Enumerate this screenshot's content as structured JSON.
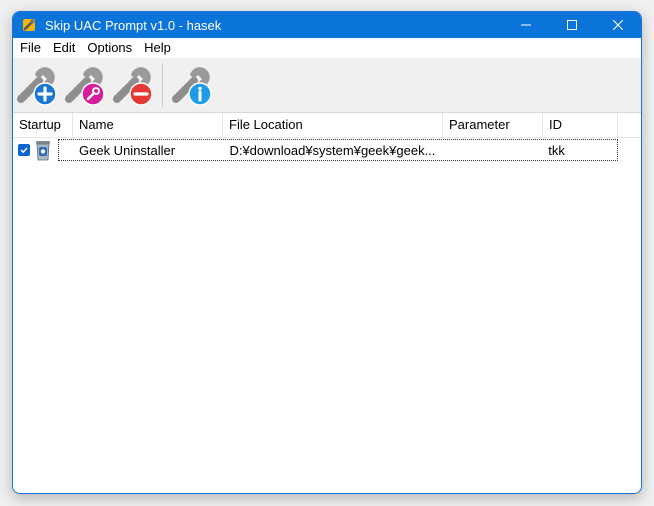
{
  "window": {
    "title": "Skip UAC Prompt v1.0 - hasek"
  },
  "menu": [
    "File",
    "Edit",
    "Options",
    "Help"
  ],
  "toolbar": {
    "buttons": [
      {
        "icon": "wrench-add-icon"
      },
      {
        "icon": "wrench-edit-icon"
      },
      {
        "icon": "wrench-remove-icon"
      },
      {
        "icon": "wrench-info-icon"
      }
    ]
  },
  "list": {
    "columns": [
      "Startup",
      "Name",
      "File Location",
      "Parameter",
      "ID"
    ],
    "rows": [
      {
        "startup_checked": true,
        "name": "Geek Uninstaller",
        "file_location": "D:¥download¥system¥geek¥geek...",
        "parameter": "",
        "id": "tkk"
      }
    ]
  },
  "colors": {
    "titlebar": "#0a74da",
    "checkbox": "#0a64d2",
    "add": "#1976d2",
    "edit": "#d81b9a",
    "remove": "#e53935",
    "info": "#1e9be8"
  }
}
